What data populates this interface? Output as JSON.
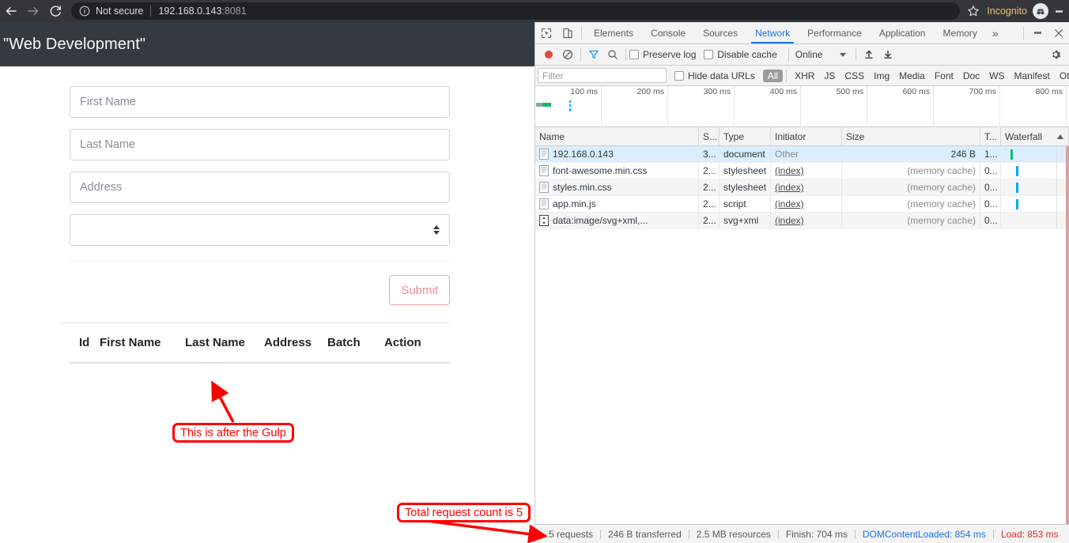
{
  "browser": {
    "back_icon": "back-arrow-icon",
    "forward_icon": "forward-arrow-icon",
    "reload_icon": "reload-icon",
    "info_icon": "info-circle-icon",
    "security_label": "Not secure",
    "url_host": "192.168.0.143",
    "url_port": ":8081",
    "bookmark_icon": "star-icon",
    "incognito_label": "Incognito",
    "incognito_icon": "incognito-avatar-icon",
    "menu_icon": "three-dot-menu-icon"
  },
  "page": {
    "title": "\"Web Development\"",
    "fields": [
      {
        "placeholder": "First Name"
      },
      {
        "placeholder": "Last Name"
      },
      {
        "placeholder": "Address"
      }
    ],
    "select": {
      "value": "",
      "arrows_icon": "select-stepper-icon"
    },
    "submit_label": "Submit",
    "table_headers": [
      "Id",
      "First Name",
      "Last Name",
      "Address",
      "Batch",
      "Action"
    ],
    "table_rows": []
  },
  "annotations": [
    {
      "text": "This is after the Gulp",
      "color": "#ff0000"
    },
    {
      "text": "Total request count is 5",
      "color": "#ff0000"
    }
  ],
  "devtools": {
    "inspect_icon": "inspect-element-icon",
    "device_icon": "device-toolbar-icon",
    "tabs": [
      {
        "label": "Elements",
        "active": false
      },
      {
        "label": "Console",
        "active": false
      },
      {
        "label": "Sources",
        "active": false
      },
      {
        "label": "Network",
        "active": true
      },
      {
        "label": "Performance",
        "active": false
      },
      {
        "label": "Application",
        "active": false
      },
      {
        "label": "Memory",
        "active": false
      }
    ],
    "more_tabs_icon": "chevron-double-right-icon",
    "panel_menu_icon": "three-dot-menu-icon",
    "close_icon": "close-icon",
    "toolbar": {
      "record_icon": "record-button-icon",
      "clear_icon": "clear-network-icon",
      "filter_icon": "funnel-filter-icon",
      "search_icon": "search-icon",
      "preserve_log_label": "Preserve log",
      "preserve_log_checked": false,
      "disable_cache_label": "Disable cache",
      "disable_cache_checked": false,
      "throttle_value": "Online",
      "import_icon": "import-har-icon",
      "export_icon": "export-har-icon",
      "settings_icon": "gear-icon"
    },
    "filterbar": {
      "filter_placeholder": "Filter",
      "hide_data_urls_label": "Hide data URLs",
      "hide_data_urls_checked": false,
      "types": [
        "All",
        "XHR",
        "JS",
        "CSS",
        "Img",
        "Media",
        "Font",
        "Doc",
        "WS",
        "Manifest",
        "Other"
      ],
      "selected_type": "All"
    },
    "overview": {
      "ticks": [
        "100 ms",
        "200 ms",
        "300 ms",
        "400 ms",
        "500 ms",
        "600 ms",
        "700 ms",
        "800 ms"
      ]
    },
    "columns": [
      "Name",
      "S...",
      "Type",
      "Initiator",
      "Size",
      "T...",
      "Waterfall"
    ],
    "sort_icon": "sort-ascending-icon",
    "requests": [
      {
        "name": "192.168.0.143",
        "status": "3...",
        "type": "document",
        "initiator": "Other",
        "size": "246 B",
        "time": "1...",
        "icon": "document-file-icon",
        "selected": true,
        "bar_color": "#0fbc61",
        "bar_left_pct": 2
      },
      {
        "name": "font-awesome.min.css",
        "status": "2...",
        "type": "stylesheet",
        "initiator": "(index)",
        "size": "(memory cache)",
        "time": "0...",
        "icon": "stylesheet-file-icon",
        "selected": false,
        "bar_color": "#00a8ff",
        "bar_left_pct": 8
      },
      {
        "name": "styles.min.css",
        "status": "2...",
        "type": "stylesheet",
        "initiator": "(index)",
        "size": "(memory cache)",
        "time": "0...",
        "icon": "stylesheet-file-icon",
        "selected": false,
        "bar_color": "#00a8ff",
        "bar_left_pct": 8
      },
      {
        "name": "app.min.js",
        "status": "2...",
        "type": "script",
        "initiator": "(index)",
        "size": "(memory cache)",
        "time": "0...",
        "icon": "script-file-icon",
        "selected": false,
        "bar_color": "#00a8ff",
        "bar_left_pct": 8
      },
      {
        "name": "data:image/svg+xml,...",
        "status": "2...",
        "type": "svg+xml",
        "initiator": "(index)",
        "size": "(memory cache)",
        "time": "0...",
        "icon": "image-file-icon",
        "selected": false,
        "bar_color": "#00a8ff",
        "bar_left_pct": 76
      }
    ],
    "status": {
      "requests": "5 requests",
      "transferred": "246 B transferred",
      "resources": "2.5 MB resources",
      "finish": "Finish: 704 ms",
      "dom_content_loaded": "DOMContentLoaded: 854 ms",
      "load": "Load: 853 ms"
    }
  }
}
